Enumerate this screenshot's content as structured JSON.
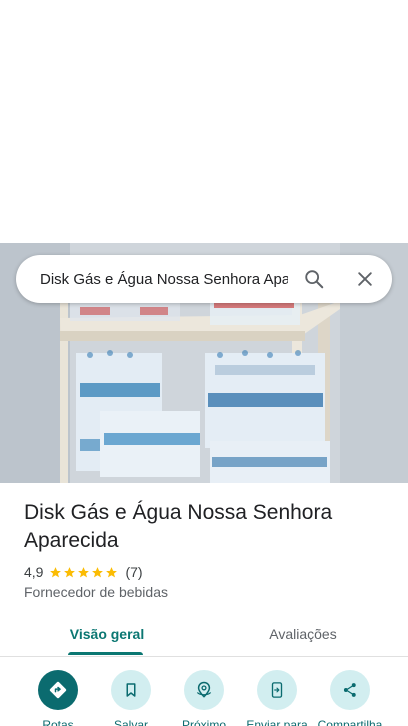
{
  "search": {
    "query": "Disk Gás e Água Nossa Senhora Apa"
  },
  "place": {
    "title": "Disk Gás e Água Nossa Senhora Aparecida",
    "rating": "4,9",
    "stars": 5,
    "review_count": "(7)",
    "category": "Fornecedor de bebidas"
  },
  "tabs": [
    {
      "label": "Visão geral",
      "active": true
    },
    {
      "label": "Avaliações",
      "active": false
    }
  ],
  "actions": [
    {
      "label": "Rotas",
      "icon": "directions-icon"
    },
    {
      "label": "Salvar",
      "icon": "bookmark-icon"
    },
    {
      "label": "Próximo",
      "icon": "nearby-icon"
    },
    {
      "label": "Enviar para",
      "icon": "send-to-phone-icon"
    },
    {
      "label": "Compartilha",
      "icon": "share-icon"
    }
  ],
  "colors": {
    "accent": "#0b7772",
    "action_bg": "#d2eef0",
    "star": "#fbbc04"
  }
}
